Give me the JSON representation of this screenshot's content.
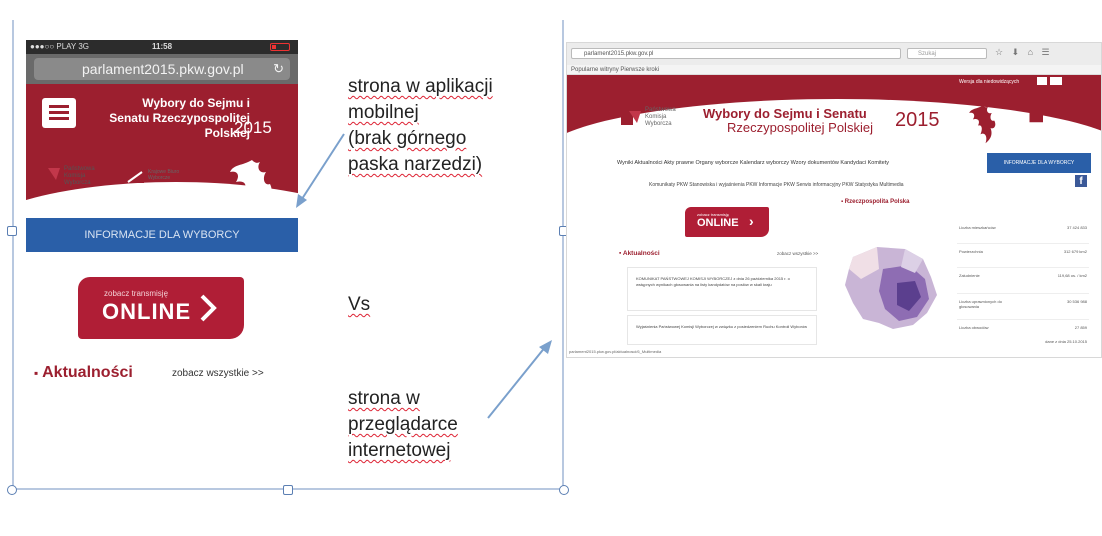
{
  "mobile": {
    "status_left": "●●●○○ PLAY 3G",
    "status_time": "11:58",
    "url": "parlament2015.pkw.gov.pl",
    "title": "Wybory do Sejmu i Senatu Rzeczypospolitej Polskiej",
    "year": "2015",
    "org": "Państwowa Komisja Wyborcza",
    "org2": "Krajowe Biuro Wyborcze",
    "info_bar": "INFORMACJE DLA WYBORCY",
    "online_small": "zobacz transmisję",
    "online_big": "ONLINE",
    "news_title": "Aktualności",
    "news_all": "zobacz wszystkie >>"
  },
  "captions": {
    "mobile_lines": [
      "strona w aplikacji",
      "mobilnej",
      "(brak górnego",
      "paska narzedzi)"
    ],
    "vs": "Vs",
    "browser_lines": [
      "strona w",
      "przeglądarce",
      "internetowej"
    ]
  },
  "desktop": {
    "url": "parlament2015.pkw.gov.pl",
    "search_placeholder": "Szukaj",
    "bookmarks": "Popularne witryny     Pierwsze kroki",
    "accessibility": "Wersja dla niedowidzących",
    "title_line1": "Wybory do Sejmu i Senatu",
    "title_line2": "Rzeczypospolitej Polskiej",
    "year": "2015",
    "org": "Państwowa Komisja Wyborcza",
    "nav": "Wyniki   Aktualności   Akty prawne   Organy wyborcze   Kalendarz wyborczy   Wzory dokumentów   Kandydaci   Komitety",
    "info_button": "INFORMACJE DLA WYBORCY",
    "subnav": "Komunikaty PKW   Stanowiska i wyjaśnienia PKW   Informacje PKW   Serwis informacyjny PKW   Statystyka   Multimedia",
    "region": "Rzeczpospolita Polska",
    "online_small": "zobacz transmisję",
    "online_big": "ONLINE",
    "news_title": "Aktualności",
    "news_all": "zobacz wszystkie >>",
    "news": [
      "KOMUNIKAT PAŃSTWOWEJ KOMISJI WYBORCZEJ z dnia 26 października 2015 r. o wstępnych wynikach głosowania na listy kandydatów na posłów w skali kraju",
      "Wyjaśnienia Państwowej Komisji Wyborczej w związku z posiedzeniem Ruchu Kontroli Wyborów"
    ],
    "stats": [
      {
        "label": "Liczba mieszkańców",
        "value": "37 424 833"
      },
      {
        "label": "Powierzchnia",
        "value": "312 679 km2"
      },
      {
        "label": "Zaludnienie",
        "value": "119,68 os. / km2"
      },
      {
        "label": "Liczba uprawnionych do głosowania",
        "value": "30 536 988"
      },
      {
        "label": "Liczba obwodów",
        "value": "27 859"
      }
    ],
    "stats_date": "dane z dnia 25.10.2015",
    "status_url": "parlament2015.pkw.gov.pl/aktualnosci/6_Multimedia"
  }
}
